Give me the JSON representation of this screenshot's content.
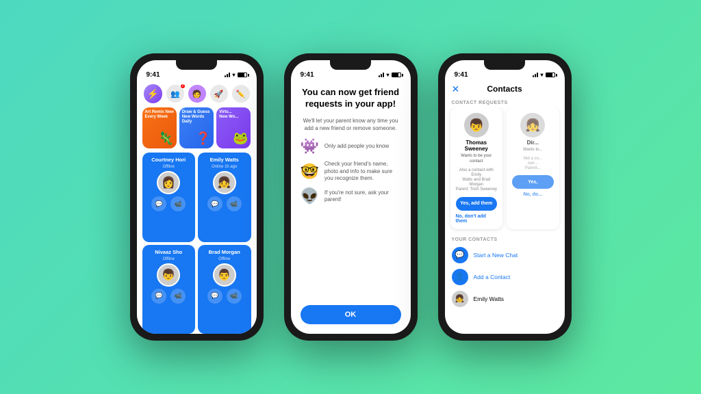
{
  "background": {
    "gradient_start": "#4dd9c0",
    "gradient_end": "#5de8a0"
  },
  "phones": [
    {
      "id": "phone1",
      "type": "messenger_home",
      "status_bar": {
        "time": "9:41",
        "signal": true,
        "wifi": true,
        "battery": true
      },
      "games": [
        {
          "label": "Art Remix\nNew Every Week",
          "emoji": "🦎",
          "color": "orange"
        },
        {
          "label": "Draw & Guess\nNew Words Daily",
          "emoji": "❓",
          "color": "blue"
        },
        {
          "label": "Virtu...\nNew Wo...",
          "emoji": "🐸",
          "color": "purple"
        }
      ],
      "contacts": [
        {
          "name": "Courtney Hori",
          "status": "Offline",
          "emoji": "👩"
        },
        {
          "name": "Emily Watts",
          "status": "Online 1h ago",
          "emoji": "👧"
        },
        {
          "name": "Nivaaz Sho",
          "status": "Offline",
          "emoji": "👦"
        },
        {
          "name": "Brad Morgan",
          "status": "Offline",
          "emoji": "👨"
        }
      ]
    },
    {
      "id": "phone2",
      "type": "friend_request_info",
      "status_bar": {
        "time": "9:41"
      },
      "title": "You can now get friend requests in your app!",
      "subtitle": "We'll let your parent know any time you add a new friend or remove someone.",
      "items": [
        {
          "emoji": "👾",
          "text": "Only add people you know"
        },
        {
          "emoji": "🤓",
          "text": "Check your friend's name, photo and info to make sure you recognize them."
        },
        {
          "emoji": "👽",
          "text": "If you're not sure, ask your parent!"
        }
      ],
      "ok_button": "OK"
    },
    {
      "id": "phone3",
      "type": "contacts",
      "status_bar": {
        "time": "9:41"
      },
      "header_title": "Contacts",
      "close_icon": "✕",
      "section_contact_requests": "CONTACT REQUESTS",
      "requests": [
        {
          "name": "Thomas Sweeney",
          "subtitle": "Wants to be your contact",
          "note": "Also a contact with Emily\nWatts and Brad Morgan\nParent: Trish Sweeney",
          "yes_label": "Yes, add them",
          "no_label": "No, don't add them",
          "emoji": "👦"
        },
        {
          "name": "Dir...",
          "subtitle": "Wants to...",
          "note": "Not a co...\ncurr...\nParent...",
          "yes_label": "Yes,",
          "no_label": "No, do...",
          "emoji": "👧"
        }
      ],
      "section_your_contacts": "YOUR CONTACTS",
      "list_items": [
        {
          "type": "chat",
          "icon": "💬",
          "text": "Start a New Chat",
          "color": "blue"
        },
        {
          "type": "add",
          "icon": "👤",
          "text": "Add a Contact",
          "color": "blue"
        },
        {
          "type": "contact",
          "emoji": "👧",
          "text": "Emily Watts",
          "color": "black"
        }
      ]
    }
  ]
}
